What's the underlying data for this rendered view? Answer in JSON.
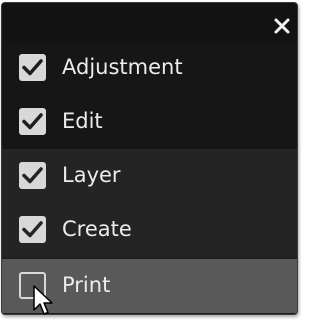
{
  "menu": {
    "close_icon": "close-icon",
    "items": [
      {
        "label": "Adjustment",
        "checked": true
      },
      {
        "label": "Edit",
        "checked": true
      },
      {
        "label": "Layer",
        "checked": true
      },
      {
        "label": "Create",
        "checked": true
      },
      {
        "label": "Print",
        "checked": false,
        "hovered": true
      }
    ]
  },
  "colors": {
    "panel_bg": "#1d1d1d",
    "hover_bg": "#595959",
    "checkbox": "#d8d8d8",
    "text": "#ececec"
  }
}
